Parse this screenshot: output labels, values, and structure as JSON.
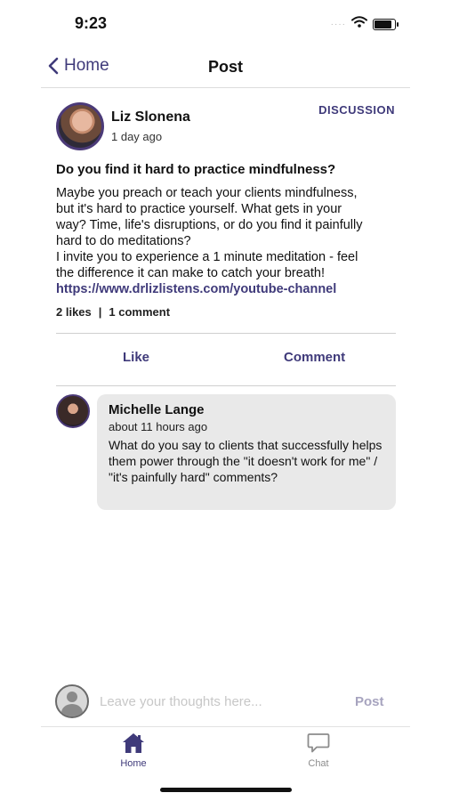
{
  "status_bar": {
    "time": "9:23",
    "signal_dots": "····",
    "battery_level": 0.85
  },
  "nav": {
    "back_label": "Home",
    "title": "Post"
  },
  "post": {
    "author": "Liz Slonena",
    "time": "1 day ago",
    "tag": "DISCUSSION",
    "title": "Do you find it hard to practice mindfulness?",
    "body_lines": [
      "Maybe you preach or teach your clients mindfulness,",
      "but it's hard to practice yourself. What gets in your",
      "way? Time, life's disruptions, or do you find it painfully",
      "hard to do meditations?",
      "I invite you to experience a 1 minute meditation - feel",
      "the difference it can make to catch your breath!"
    ],
    "link": "https://www.drlizlistens.com/youtube-channel",
    "likes": "2 likes",
    "stats_separator": "|",
    "comments_count": "1 comment"
  },
  "actions": {
    "like_label": "Like",
    "comment_label": "Comment"
  },
  "comment": {
    "author": "Michelle Lange",
    "time": "about 11 hours ago",
    "text": "What do you say to clients that successfully helps them power through the \"it doesn't work for me\" / \"it's painfully hard\" comments?"
  },
  "composer": {
    "placeholder": "Leave your thoughts here...",
    "value": "",
    "post_label": "Post"
  },
  "tabs": [
    {
      "label": "Home",
      "icon": "home-icon",
      "active": true
    },
    {
      "label": "Chat",
      "icon": "chat-icon",
      "active": false
    }
  ],
  "colors": {
    "accent": "#3f3a7a",
    "bubble": "#e9e9e9",
    "inactive": "#8c8c8c",
    "post_disabled": "#a7a4bf"
  }
}
